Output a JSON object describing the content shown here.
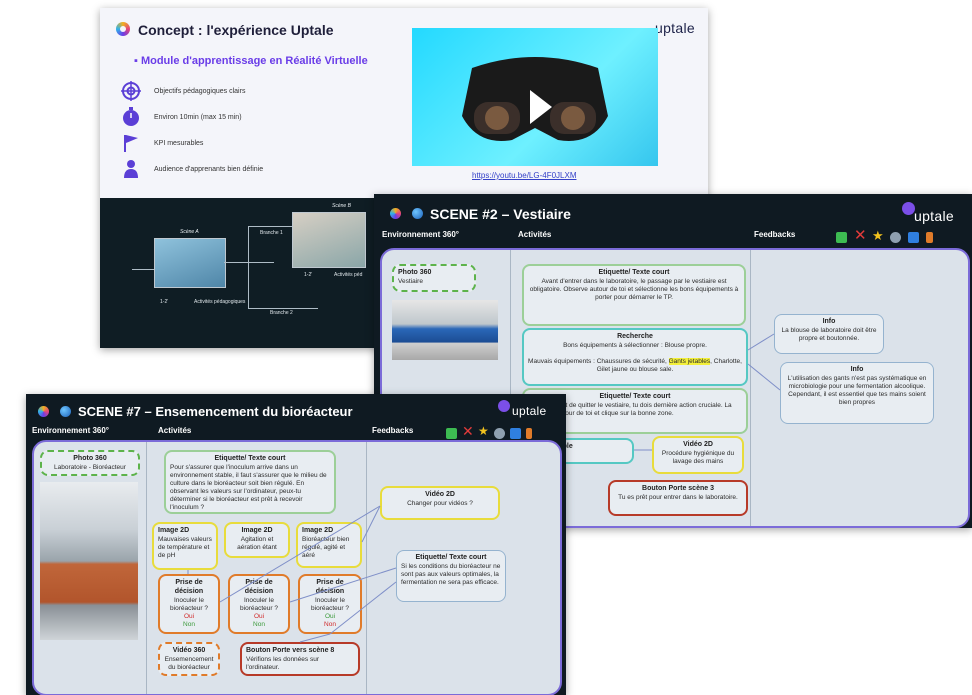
{
  "slide1": {
    "title": "Concept : l'expérience Uptale",
    "brand": "uptale",
    "subtitle": "▪ Module d'apprentissage en Réalité Virtuelle",
    "features": [
      {
        "icon": "target-icon",
        "label": "Objectifs pédagogiques clairs"
      },
      {
        "icon": "timer-icon",
        "label": "Environ 10min (max 15 min)"
      },
      {
        "icon": "flag-icon",
        "label": "KPI mesurables"
      },
      {
        "icon": "person-icon",
        "label": "Audience d'apprenants bien définie"
      }
    ],
    "video_link": "https://youtu.be/LG-4F0JLXM",
    "diagram": {
      "scene_a": "Scène A",
      "scene_b": "Scène B",
      "branch1": "Branche 1",
      "branch2": "Branche 2",
      "duration_a": "1-2'",
      "duration_b": "1-2'",
      "activities_a": "Activités pédagogiques",
      "activities_b": "Activités péd"
    }
  },
  "slide2": {
    "title": "SCENE #2 – Vestiaire",
    "brand": "uptale",
    "col_env": "Environnement 360°",
    "col_act": "Activités",
    "col_fb": "Feedbacks",
    "photo_title": "Photo 360",
    "photo_label": "Vestiaire",
    "card1_title": "Etiquette/ Texte court",
    "card1_text": "Avant d'entrer dans le laboratoire, le passage par le vestiaire est obligatoire. Observe autour de toi et sélectionne les bons équipements à porter pour démarrer le TP.",
    "card2_title": "Recherche",
    "card2_line1": "Bons équipements à sélectionner : Blouse propre.",
    "card2_line2_pre": "Mauvais équipements : Chaussures de sécurité, ",
    "card2_highlight": "Gants jetables",
    "card2_line2_post": ", Charlotte, Gilet jaune ou blouse sale.",
    "card3_title": "Etiquette/ Texte court",
    "card3_text": "équipé. Avant de quitter le vestiaire, tu dois dernière action cruciale. La devines-tu ? our de toi et clique sur la bonne zone.",
    "card4_title": "rche invisible",
    "card4_text": "avabo",
    "card5_title": "Vidéo 2D",
    "card5_text": "Procédure hygiénique du lavage des mains",
    "card6_title": "Bouton Porte scène 3",
    "card6_text": "Tu es prêt pour entrer dans le laboratoire.",
    "info1_title": "Info",
    "info1_text": "La blouse de laboratoire doit être propre et boutonnée.",
    "info2_title": "Info",
    "info2_text": "L'utilisation des gants n'est pas systématique en microbiologie pour une fermentation alcoolique. Cependant, il est essentiel que tes mains soient bien propres"
  },
  "slide3": {
    "title": "SCENE #7 – Ensemencement du bioréacteur",
    "brand": "uptale",
    "col_env": "Environnement 360°",
    "col_act": "Activités",
    "col_fb": "Feedbacks",
    "photo_title": "Photo 360",
    "photo_label": "Laboratoire - Bioréacteur",
    "card1_title": "Etiquette/ Texte court",
    "card1_text": "Pour s'assurer que l'inoculum arrive dans un environnement stable, il faut s'assurer que le milieu de culture dans le bioréacteur soit bien régulé. En observant les valeurs sur l'ordinateur, peux-tu déterminer si le bioréacteur est prêt à recevoir l'inoculum ?",
    "img1_title": "Image 2D",
    "img1_text": "Mauvaises valeurs de température et de pH",
    "img2_title": "Image 2D",
    "img2_text": "Agitation et aération étant",
    "img3_title": "Image 2D",
    "img3_text": "Bioréacteur bien régulé, agité et aéré",
    "dec_title": "Prise de décision",
    "dec_text": "Inoculer le bioréacteur ?",
    "oui": "Oui",
    "non": "Non",
    "vid360_title": "Vidéo 360",
    "vid360_text": "Ensemencement du bioréacteur",
    "btn_title": "Bouton Porte vers scène 8",
    "btn_text": "Vérifions les données sur l'ordinateur.",
    "fb1_title": "Vidéo 2D",
    "fb1_text": "Changer pour vidéos ?",
    "fb2_title": "Etiquette/ Texte court",
    "fb2_text": "Si les conditions du bioréacteur ne sont pas aux valeurs optimales, la fermentation ne sera pas efficace."
  },
  "colors": {
    "dark_bg": "#0f1a22",
    "panel": "#dbe2ea",
    "accent_purple": "#7b6bd8",
    "green": "#5db34b",
    "teal": "#55c8c3",
    "yellow": "#e8dc3c",
    "red": "#b73a28",
    "orange": "#e07b2a"
  }
}
